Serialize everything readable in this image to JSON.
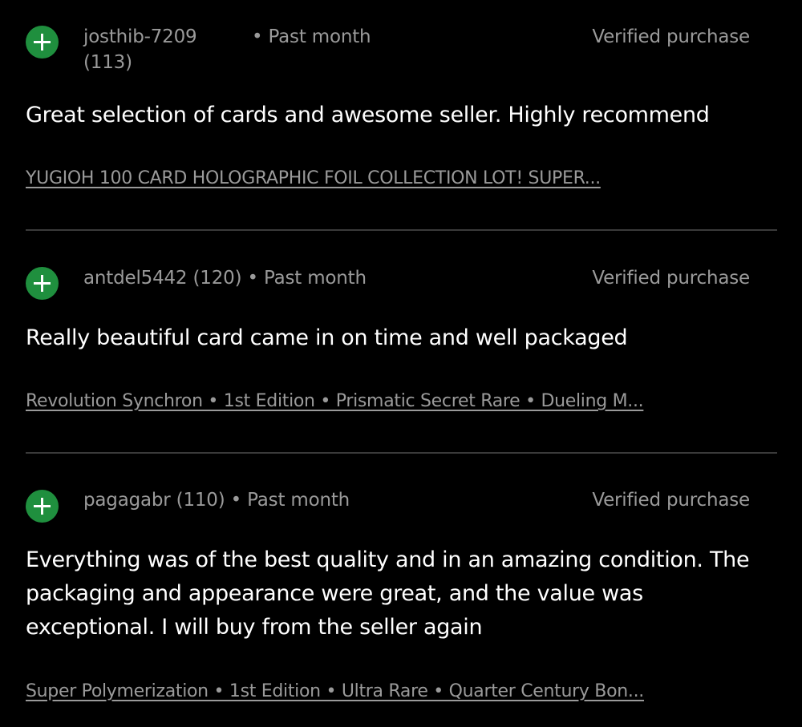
{
  "colors": {
    "background": "#000000",
    "accent_green": "#1f8f3e",
    "muted_text": "#9a9a9a",
    "body_text": "#ffffff",
    "divider": "#3a3a3a"
  },
  "reviews": [
    {
      "icon": "plus-circle-icon",
      "user": "josthib-7209",
      "score": "(113)",
      "separator": "•",
      "time": "Past month",
      "verified": "Verified purchase",
      "text": "Great selection of cards and awesome seller. Highly recommend",
      "item": "YUGIOH 100 CARD HOLOGRAPHIC FOIL COLLECTION LOT! SUPER..."
    },
    {
      "icon": "plus-circle-icon",
      "user": "antdel5442",
      "score": "(120)",
      "separator": "•",
      "time": "Past month",
      "verified": "Verified purchase",
      "text": "Really beautiful card came in on time and well packaged",
      "item": "Revolution Synchron • 1st Edition • Prismatic Secret Rare • Dueling M..."
    },
    {
      "icon": "plus-circle-icon",
      "user": "pagagabr",
      "score": "(110)",
      "separator": "•",
      "time": "Past month",
      "verified": "Verified purchase",
      "text": "Everything was of the best quality and in an amazing condition. The packaging and appearance were great, and the value was exceptional. I will buy from the seller again",
      "item": "Super Polymerization • 1st Edition • Ultra Rare • Quarter Century Bon..."
    }
  ]
}
